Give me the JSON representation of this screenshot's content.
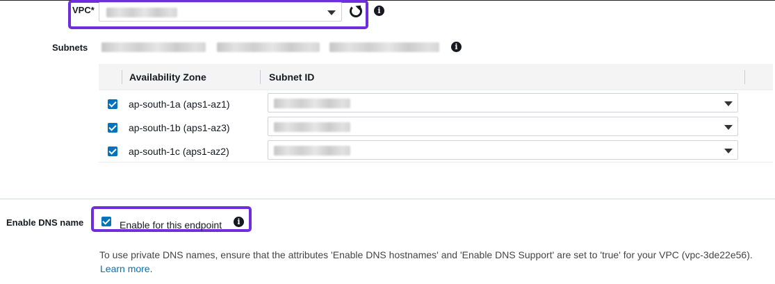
{
  "vpc": {
    "label": "VPC*",
    "icons": [
      "chevron-down-icon",
      "refresh-icon",
      "info-icon"
    ]
  },
  "subnets": {
    "label": "Subnets",
    "info_icon": "i"
  },
  "table": {
    "columns": [
      "Availability Zone",
      "Subnet ID"
    ],
    "rows": [
      {
        "zone": "ap-south-1a (aps1-az1)",
        "checked": true
      },
      {
        "zone": "ap-south-1b (aps1-az3)",
        "checked": true
      },
      {
        "zone": "ap-south-1c (aps1-az2)",
        "checked": true
      }
    ]
  },
  "dns": {
    "label": "Enable DNS name",
    "checkbox_label": "Enable for this endpoint",
    "checked": true,
    "info_icon": "i",
    "description": "To use private DNS names, ensure that the attributes 'Enable DNS hostnames' and 'Enable DNS Support' are set to 'true' for your VPC (vpc-3de22e56).",
    "learn_more": "Learn more",
    "learn_more_suffix": "."
  },
  "colors": {
    "highlight": "#6f2ddb",
    "checkbox": "#0073bb",
    "link": "#0073bb"
  }
}
